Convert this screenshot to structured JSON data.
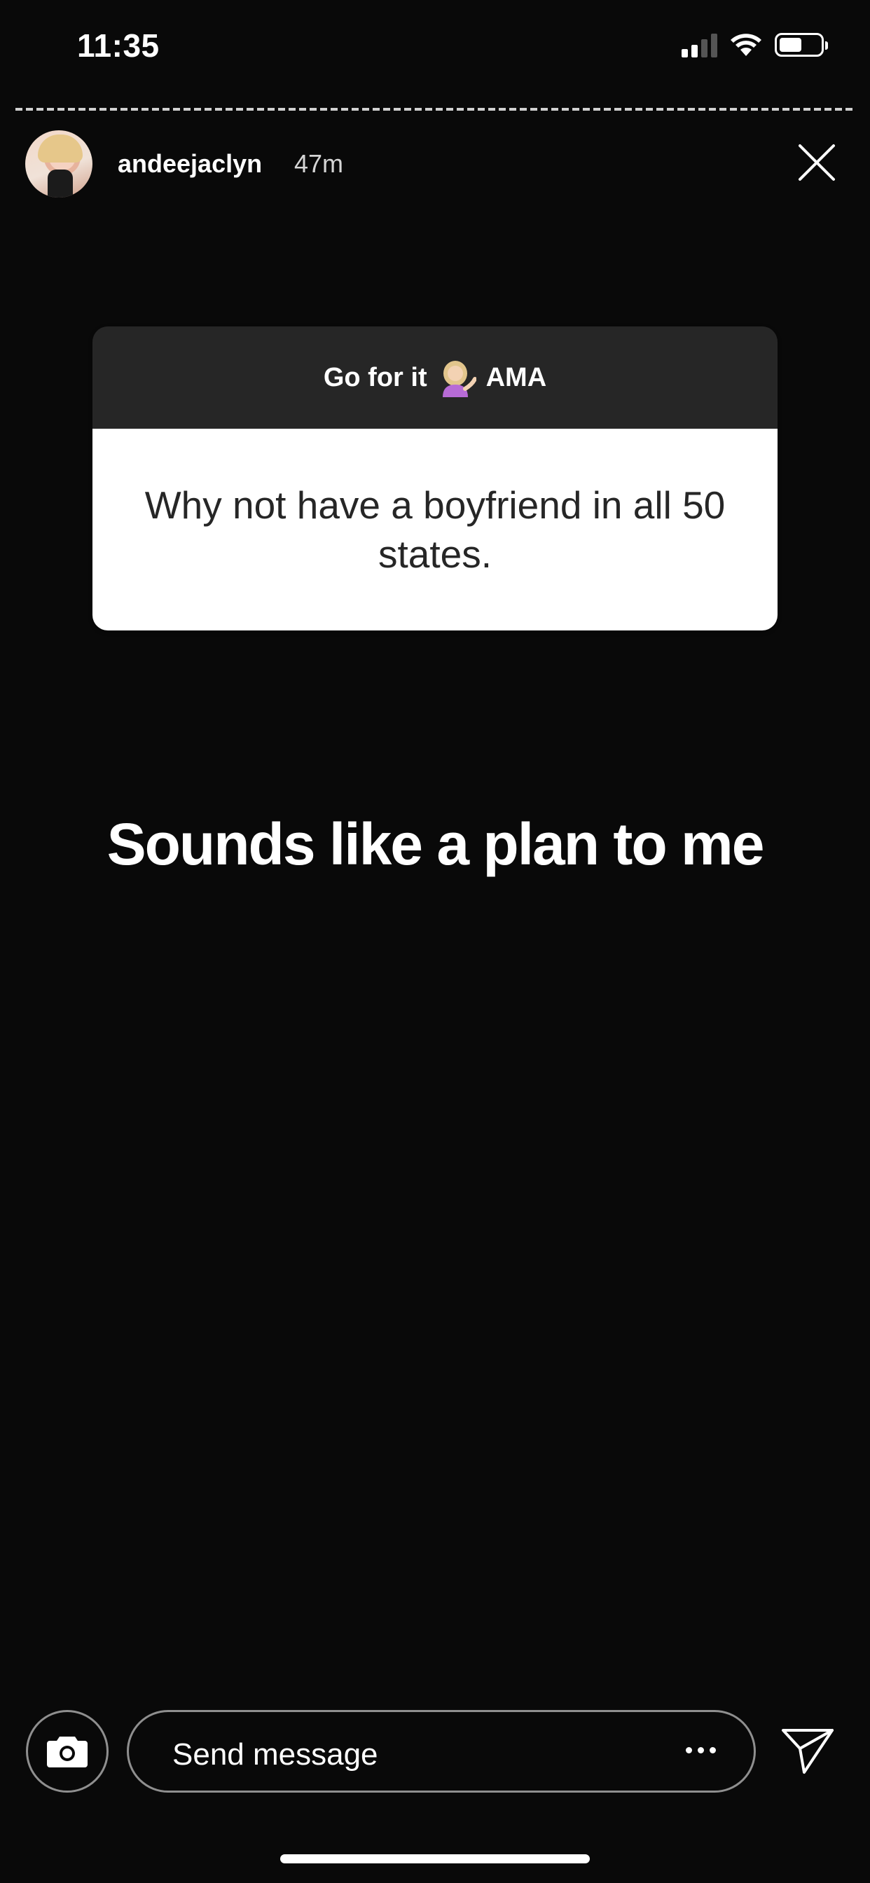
{
  "status_bar": {
    "time": "11:35",
    "signal_icon": "cellular-signal-icon",
    "wifi_icon": "wifi-icon",
    "battery_icon": "battery-icon"
  },
  "story": {
    "username": "andeejaclyn",
    "time_ago": "47m",
    "close_icon": "close-icon"
  },
  "question_sticker": {
    "prompt": "Go for it",
    "prompt_suffix": "AMA",
    "emoji": "person-tipping-hand-emoji",
    "question": "Why not have a boyfriend in all 50 states."
  },
  "caption": "Sounds like a plan to me",
  "reply_bar": {
    "camera_icon": "camera-icon",
    "placeholder": "Send message",
    "more_icon": "more-horizontal-icon",
    "send_icon": "paper-plane-send-icon"
  },
  "colors": {
    "background": "#090909",
    "sticker_header": "#262626",
    "sticker_body": "#ffffff",
    "sticker_text": "#262626"
  }
}
